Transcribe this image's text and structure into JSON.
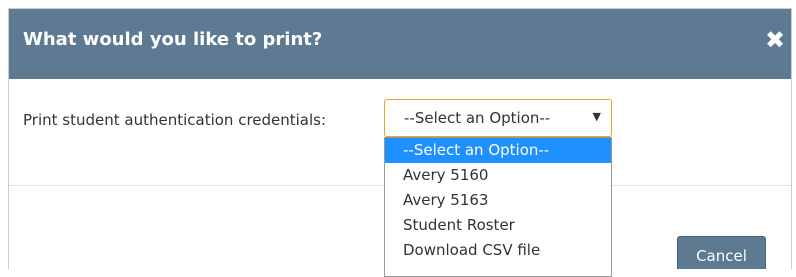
{
  "dialog": {
    "title": "What would you like to print?",
    "close_glyph": "✖",
    "close_icon": "close-icon"
  },
  "form": {
    "label": "Print student authentication credentials:",
    "select_value": "--Select an Option--",
    "arrow_glyph": "▼"
  },
  "dropdown": {
    "options": [
      "--Select an Option--",
      "Avery 5160",
      "Avery 5163",
      "Student Roster",
      "Download CSV file"
    ],
    "highlighted": "--Select an Option--"
  },
  "footer": {
    "cancel_label": "Cancel"
  },
  "colors": {
    "header": "#5d7a92",
    "select_border": "#e3a52e",
    "highlight": "#1e90ff"
  }
}
